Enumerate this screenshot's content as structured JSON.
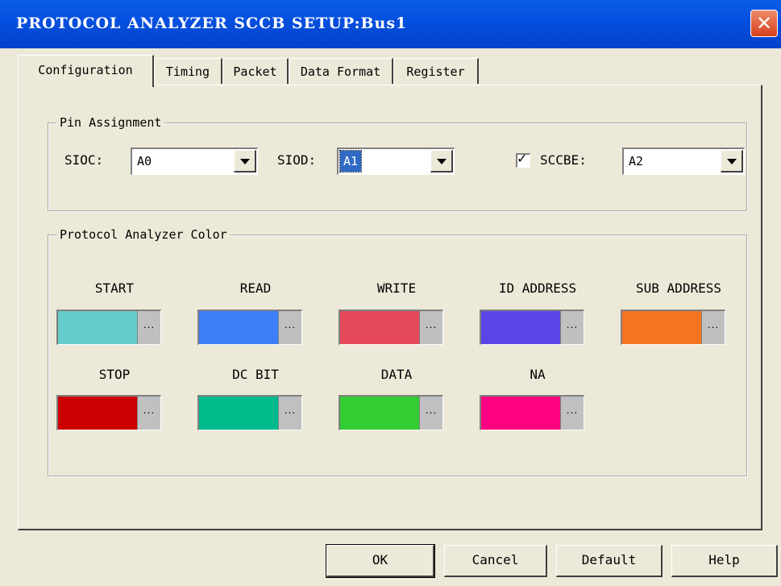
{
  "window": {
    "title": "PROTOCOL ANALYZER SCCB SETUP:Bus1",
    "close_glyph": "✕"
  },
  "tabs": [
    {
      "label": "Configuration",
      "active": true
    },
    {
      "label": "Timing",
      "active": false
    },
    {
      "label": "Packet",
      "active": false
    },
    {
      "label": "Data Format",
      "active": false
    },
    {
      "label": "Register",
      "active": false
    }
  ],
  "pin_assignment": {
    "legend": "Pin Assignment",
    "sioc": {
      "label": "SIOC:",
      "value": "A0"
    },
    "siod": {
      "label": "SIOD:",
      "value": "A1"
    },
    "sccbe": {
      "label": "SCCBE:",
      "checked": true,
      "check_glyph": "✓",
      "value": "A2"
    }
  },
  "colors": {
    "legend": "Protocol Analyzer Color",
    "more_label": "...",
    "items": [
      {
        "label": "START",
        "color": "#66cccc"
      },
      {
        "label": "READ",
        "color": "#3d7ff7"
      },
      {
        "label": "WRITE",
        "color": "#e6485c"
      },
      {
        "label": "ID ADDRESS",
        "color": "#5b45e8"
      },
      {
        "label": "SUB ADDRESS",
        "color": "#f77520"
      },
      {
        "label": "STOP",
        "color": "#cc0000"
      },
      {
        "label": "DC BIT",
        "color": "#00bb8c"
      },
      {
        "label": "DATA",
        "color": "#33cc33"
      },
      {
        "label": "NA",
        "color": "#ff0080"
      }
    ]
  },
  "buttons": {
    "ok": "OK",
    "cancel": "Cancel",
    "default": "Default",
    "help": "Help"
  }
}
